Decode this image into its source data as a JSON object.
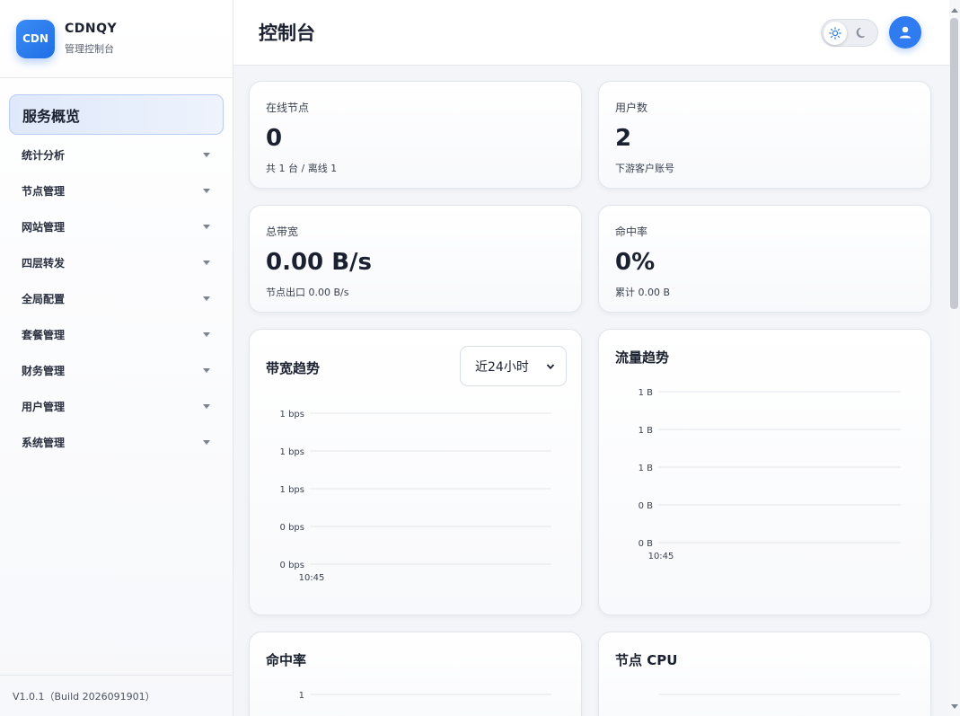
{
  "brand": {
    "logo_text": "CDN",
    "name": "CDNQY",
    "subtitle": "管理控制台"
  },
  "sidebar": {
    "active": "服务概览",
    "items": [
      {
        "label": "统计分析"
      },
      {
        "label": "节点管理"
      },
      {
        "label": "网站管理"
      },
      {
        "label": "四层转发"
      },
      {
        "label": "全局配置"
      },
      {
        "label": "套餐管理"
      },
      {
        "label": "财务管理"
      },
      {
        "label": "用户管理"
      },
      {
        "label": "系统管理"
      }
    ],
    "footer": "V1.0.1（Build 2026091901）"
  },
  "header": {
    "title": "控制台",
    "theme_icons": [
      "sun-icon",
      "moon-icon"
    ],
    "avatar_icon": "user-icon"
  },
  "stats": {
    "online_nodes": {
      "label": "在线节点",
      "value": "0",
      "sub": "共 1 台 / 离线 1"
    },
    "users": {
      "label": "用户数",
      "value": "2",
      "sub": "下游客户账号"
    },
    "bandwidth": {
      "label": "总带宽",
      "value": "0.00 B/s",
      "sub": "节点出口 0.00 B/s"
    },
    "hit_rate": {
      "label": "命中率",
      "value": "0%",
      "sub": "累计 0.00 B"
    }
  },
  "colors": {
    "accent": "#2f7bf0",
    "grid": "#e3e6eb",
    "tick": "#3b4250"
  },
  "chart_data": [
    {
      "type": "line",
      "title": "带宽趋势",
      "range_select": "近24小时",
      "x": [
        "10:45"
      ],
      "y_ticks": [
        "1 bps",
        "1 bps",
        "1 bps",
        "0 bps",
        "0 bps"
      ],
      "series": [
        {
          "values": [
            0
          ]
        }
      ],
      "grid": true
    },
    {
      "type": "line",
      "title": "流量趋势",
      "x": [
        "10:45"
      ],
      "y_ticks": [
        "1 B",
        "1 B",
        "1 B",
        "0 B",
        "0 B"
      ],
      "series": [
        {
          "values": [
            0
          ]
        }
      ],
      "grid": true
    },
    {
      "type": "line",
      "title": "命中率",
      "y_ticks": [
        "1"
      ],
      "grid": true
    },
    {
      "type": "line",
      "title": "节点 CPU",
      "grid": true
    }
  ]
}
